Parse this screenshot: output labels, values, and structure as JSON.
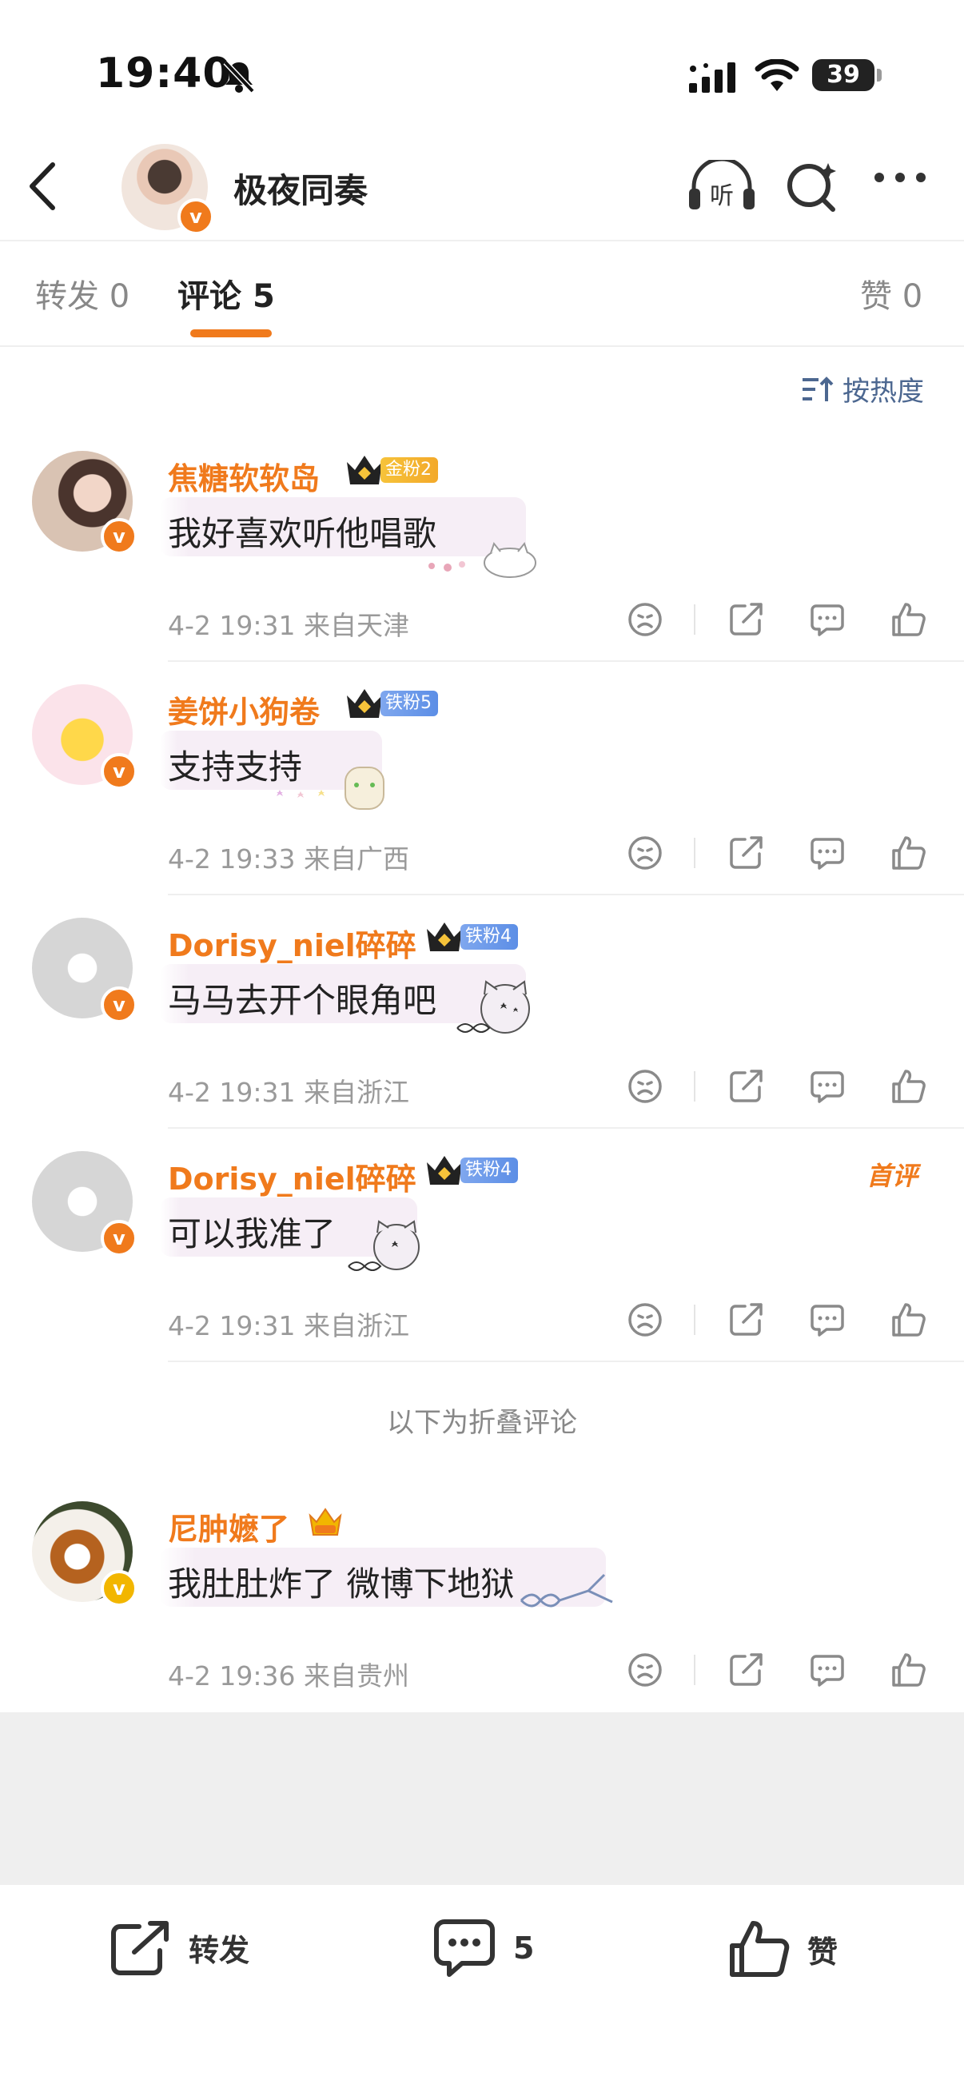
{
  "status_bar": {
    "time": "19:40",
    "battery": "39"
  },
  "header": {
    "title": "极夜同奏"
  },
  "tabs": {
    "repost": {
      "label": "转发",
      "count": "0"
    },
    "comment": {
      "label": "评论",
      "count": "5"
    },
    "like": {
      "label": "赞",
      "count": "0"
    }
  },
  "sort": {
    "label": "按热度"
  },
  "comments": [
    {
      "name": "焦糖软软岛",
      "fan_badge": "金粉2",
      "text": "我好喜欢听他唱歌",
      "meta": "4-2 19:31 来自天津"
    },
    {
      "name": "姜饼小狗卷",
      "fan_badge": "铁粉5",
      "text": "支持支持",
      "meta": "4-2 19:33 来自广西"
    },
    {
      "name": "Dorisy_niel碎碎",
      "fan_badge": "铁粉4",
      "text": "马马去开个眼角吧",
      "meta": "4-2 19:31 来自浙江"
    },
    {
      "name": "Dorisy_niel碎碎",
      "fan_badge": "铁粉4",
      "text": "可以我准了",
      "meta": "4-2 19:31 来自浙江",
      "tag": "首评"
    }
  ],
  "fold_label": "以下为折叠评论",
  "folded_comments": [
    {
      "name": "尼肿嬷了",
      "text": "我肚肚炸了 微博下地狱",
      "meta": "4-2 19:36 来自贵州"
    }
  ],
  "bottom_bar": {
    "repost_label": "转发",
    "comment_count": "5",
    "like_label": "赞"
  },
  "colors": {
    "accent": "#f07a1c",
    "link": "#4c6790",
    "meta": "#9a9a9a"
  }
}
